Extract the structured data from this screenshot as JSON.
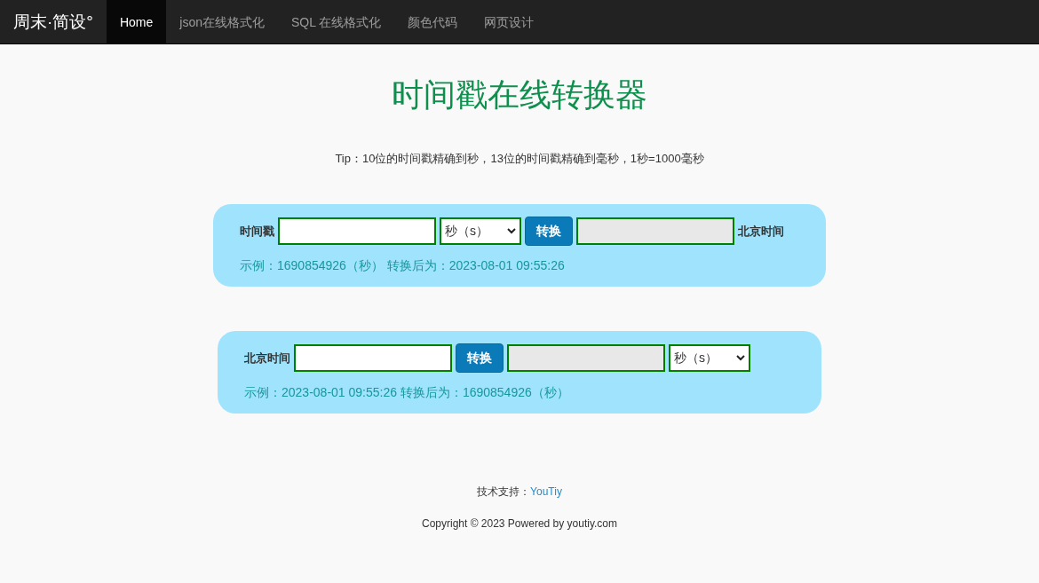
{
  "navbar": {
    "brand": "周末·简设°",
    "links": [
      {
        "label": "Home",
        "selected": true
      },
      {
        "label": "json在线格式化",
        "selected": false
      },
      {
        "label": "SQL 在线格式化",
        "selected": false
      },
      {
        "label": "颜色代码",
        "selected": false
      },
      {
        "label": "网页设计",
        "selected": false
      }
    ]
  },
  "title": "时间戳在线转换器",
  "tip": "Tip：10位的时间戳精确到秒，13位的时间戳精确到毫秒，1秒=1000毫秒",
  "converters": [
    {
      "controls": [
        {
          "kind": "label",
          "text": "时间戳"
        },
        {
          "kind": "input"
        },
        {
          "kind": "select",
          "value": "秒（s）"
        },
        {
          "kind": "button",
          "text": "转换"
        },
        {
          "kind": "output"
        },
        {
          "kind": "label",
          "text": "北京时间"
        }
      ],
      "example": "示例：1690854926（秒） 转换后为：2023-08-01 09:55:26"
    },
    {
      "controls": [
        {
          "kind": "label",
          "text": "北京时间"
        },
        {
          "kind": "input"
        },
        {
          "kind": "button",
          "text": "转换"
        },
        {
          "kind": "output"
        },
        {
          "kind": "select",
          "value": "秒（s）"
        }
      ],
      "example": "示例：2023-08-01 09:55:26 转换后为：1690854926（秒）"
    }
  ],
  "footer": {
    "support_label": "技术支持：",
    "support_link": "YouTiy",
    "copyright": "Copyright © 2023 Powered by youtiy.com"
  }
}
